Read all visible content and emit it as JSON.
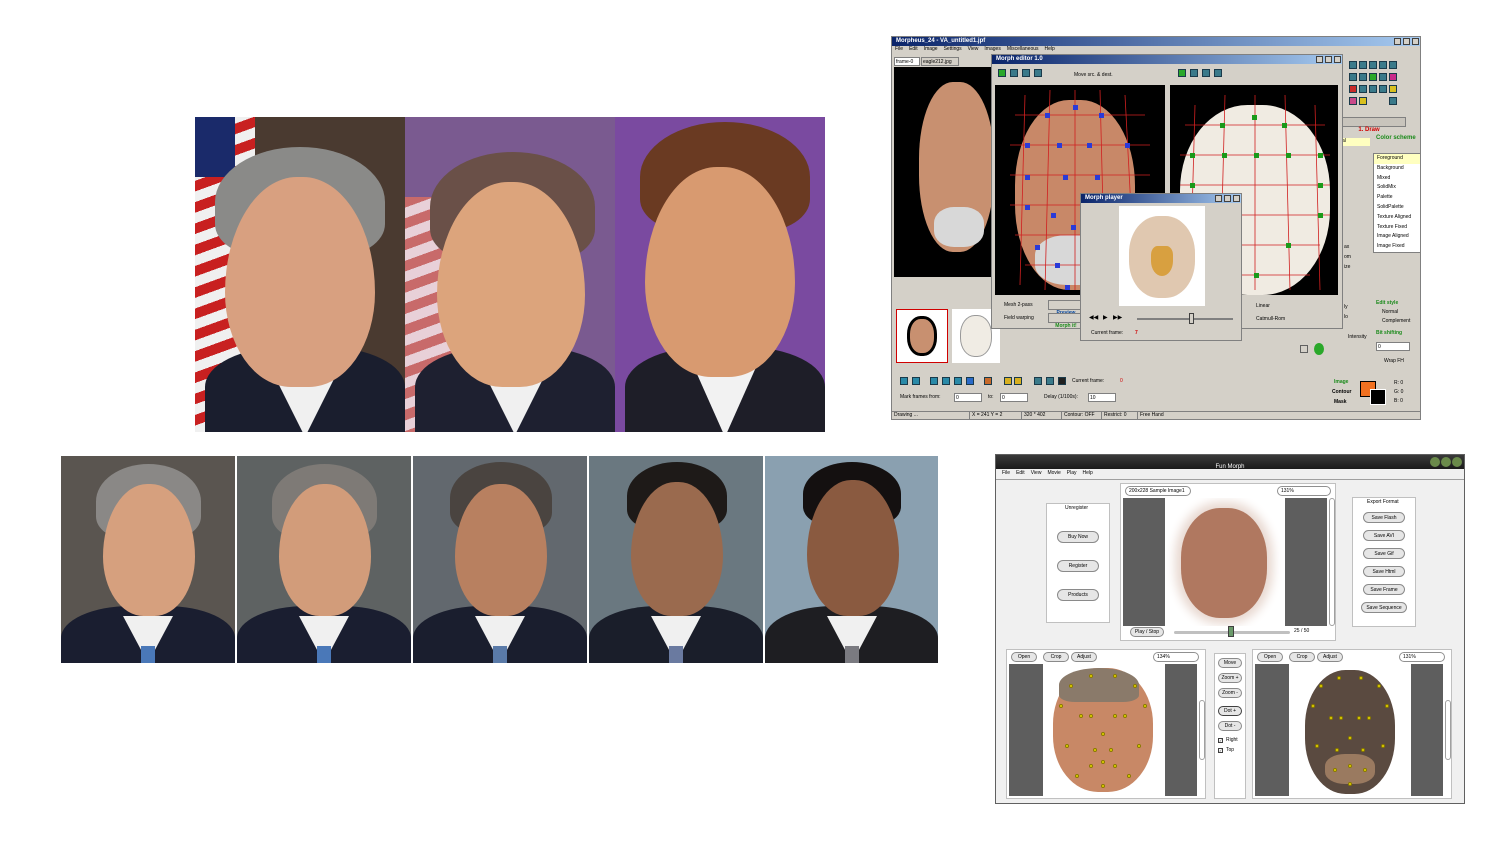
{
  "morph_examples": {
    "three_way": {
      "frames": [
        "bush",
        "blend",
        "arnold"
      ]
    },
    "five_way": {
      "frames": [
        "bush",
        "bush2",
        "mix",
        "obama2",
        "obama"
      ]
    }
  },
  "morpheus_app": {
    "window_title": "Morpheus_24 - VA_untitled1.jpf",
    "menu": [
      "File",
      "Edit",
      "Image",
      "Settings",
      "View",
      "Images",
      "Miscellaneous",
      "Help"
    ],
    "tabs": [
      "frame-0",
      "eagle212.jpg"
    ],
    "morph_editor": {
      "title": "Morph editor 1.0",
      "move_option": "Move src. & dest.",
      "mesh_option": "Mesh 2-pass",
      "field_option": "Field warping",
      "preview_button": "Preview",
      "morph_button": "Morph it!",
      "linear_option": "Linear",
      "catmull_option": "Catmull-Rom"
    },
    "morph_player": {
      "title": "Morph player",
      "current_frame_label": "Current frame:",
      "current_frame_value": "7"
    },
    "right_panel": {
      "draw_label": "1. Draw",
      "color_scheme_label": "Color scheme",
      "scheme_items": [
        "Foreground",
        "Background",
        "Mixed",
        "SolidMix",
        "Palette",
        "SolidPalette",
        "Texture Aligned",
        "Texture Fixed",
        "Image Aligned",
        "Image Fixed"
      ],
      "edit_style_label": "Edit style",
      "normal_option": "Normal",
      "complement_option": "Complement",
      "bit_shifting_label": "Bit shifting",
      "bit_value": "0",
      "wrap_label": "Wrap FH",
      "intensity_label": "Intensity",
      "image_label": "Image",
      "contour_label": "Contour",
      "mask_label": "Mask",
      "rgb": [
        "R: 0",
        "G: 0",
        "B: 0"
      ],
      "partial_labels": [
        "al",
        "ly",
        "lo",
        "er",
        "ax",
        "om",
        "ize"
      ]
    },
    "bottom": {
      "current_frame_label": "Current frame:",
      "current_frame_value": "0",
      "mark_frames_label": "Mark frames from:",
      "from_value": "0",
      "to_label": "to:",
      "to_value": "0",
      "delay_label": "Delay (1/100s):",
      "delay_value": "10"
    },
    "status": [
      "Drawing ...",
      "X = 241 Y = 2",
      "320 * 402",
      "Contour: OFF",
      "Restrict: 0",
      "Free Hand"
    ]
  },
  "fun_morph": {
    "title": "Fun Morph",
    "menu": [
      "File",
      "Edit",
      "View",
      "Movie",
      "Play",
      "Help"
    ],
    "unregister_label": "Unregister",
    "left_buttons": [
      "Buy Now",
      "Register",
      "Products"
    ],
    "image_select": "200x228 Sample Image1",
    "zoom_top": "131%",
    "play_button": "Play / Stop",
    "frame_counter": "25 / 50",
    "export_label": "Export Format",
    "export_buttons": [
      "Save Flash",
      "Save AVI",
      "Save Gif",
      "Save Html",
      "Save Frame",
      "Save Sequence"
    ],
    "left_panel": {
      "buttons": [
        "Open",
        "Crop",
        "Adjust"
      ],
      "zoom": "134%"
    },
    "right_panel": {
      "buttons": [
        "Open",
        "Crop",
        "Adjust"
      ],
      "zoom": "131%"
    },
    "middle_buttons": [
      "Move",
      "Zoom +",
      "Zoom -",
      "Dot +",
      "Dot -"
    ],
    "right_check": "Right",
    "top_check": "Top"
  },
  "colors": {
    "win_gray": "#d4d0c8",
    "title_blue": "#0a246a",
    "purple_bg": "#7a4aa0",
    "accent_red": "#d00000"
  }
}
